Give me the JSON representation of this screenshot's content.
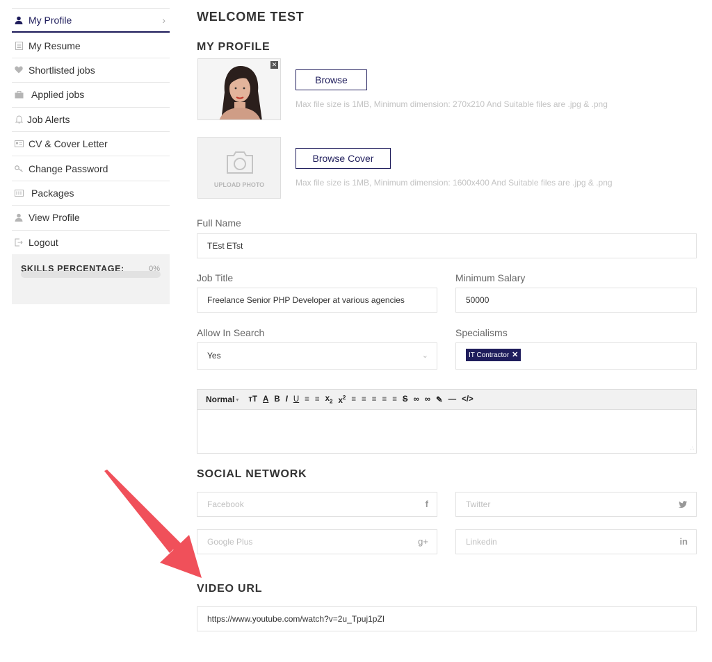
{
  "sidebar": {
    "items": [
      {
        "label": "My Profile",
        "icon": "user-icon",
        "active": true
      },
      {
        "label": "My Resume",
        "icon": "resume-icon"
      },
      {
        "label": "Shortlisted jobs",
        "icon": "heart-icon"
      },
      {
        "label": "Applied jobs",
        "icon": "briefcase-icon"
      },
      {
        "label": "Job Alerts",
        "icon": "bell-icon"
      },
      {
        "label": "CV & Cover Letter",
        "icon": "cv-icon"
      },
      {
        "label": "Change Password",
        "icon": "key-icon"
      },
      {
        "label": "Packages",
        "icon": "package-icon"
      },
      {
        "label": "View Profile",
        "icon": "user-icon"
      },
      {
        "label": "Logout",
        "icon": "logout-icon"
      }
    ],
    "skills": {
      "label": "SKILLS PERCENTAGE:",
      "percent_text": "0%",
      "percent": 0
    }
  },
  "main": {
    "welcome": "WELCOME TEST",
    "profile_heading": "MY PROFILE",
    "browse_label": "Browse",
    "browse_hint": "Max file size is 1MB, Minimum dimension: 270x210 And Suitable files are .jpg & .png",
    "upload_caption": "UPLOAD PHOTO",
    "browse_cover_label": "Browse Cover",
    "cover_hint": "Max file size is 1MB, Minimum dimension: 1600x400 And Suitable files are .jpg & .png",
    "full_name_label": "Full Name",
    "full_name_value": "TEst ETst",
    "job_title_label": "Job Title",
    "job_title_value": "Freelance Senior PHP Developer at various agencies",
    "min_salary_label": "Minimum Salary",
    "min_salary_value": "50000",
    "allow_search_label": "Allow In Search",
    "allow_search_value": "Yes",
    "specialisms_label": "Specialisms",
    "specialism_tag": "IT Contractor",
    "editor_format": "Normal",
    "social_heading": "SOCIAL NETWORK",
    "facebook_placeholder": "Facebook",
    "twitter_placeholder": "Twitter",
    "google_placeholder": "Google Plus",
    "linkedin_placeholder": "Linkedin",
    "video_heading": "VIDEO URL",
    "video_url": "https://www.youtube.com/watch?v=2u_Tpuj1pZI"
  },
  "colors": {
    "brand": "#1f1d5c",
    "annotation_arrow": "#f0505a"
  }
}
